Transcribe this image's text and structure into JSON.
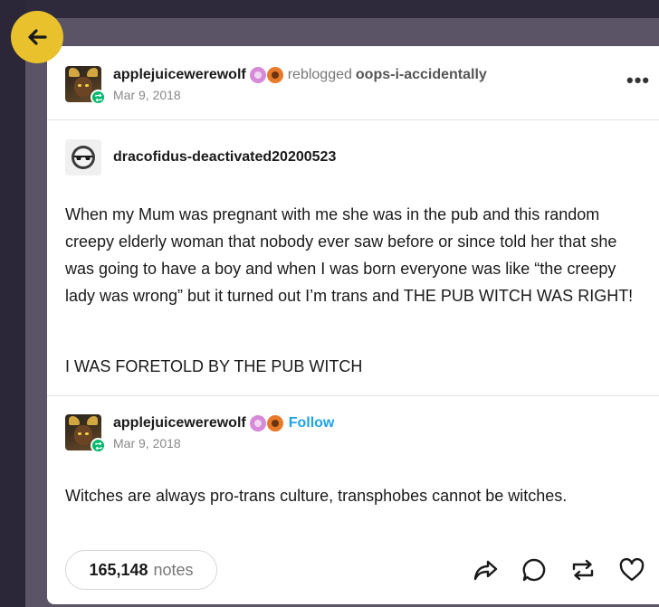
{
  "reblogger": {
    "username": "applejuicewerewolf",
    "action": "reblogged",
    "source": "oops-i-accidentally",
    "date": "Mar 9, 2018",
    "more_label": "•••"
  },
  "original_post": {
    "username": "dracofidus-deactivated20200523",
    "paragraphs": [
      "When my Mum was pregnant with me she was in the pub and this random creepy elderly woman that nobody ever saw before or since told her that she was going to have a boy and when I was born everyone was like “the creepy lady was wrong” but it turned out I’m trans and THE PUB WITCH WAS RIGHT!",
      "I WAS FORETOLD BY THE PUB WITCH"
    ]
  },
  "reply": {
    "username": "applejuicewerewolf",
    "follow_label": "Follow",
    "date": "Mar 9, 2018",
    "text": "Witches are always pro-trans culture, transphobes cannot be witches."
  },
  "footer": {
    "notes_count": "165,148",
    "notes_label": "notes"
  },
  "icons": {
    "back": "arrow-left-icon",
    "share": "share-icon",
    "reply": "comment-icon",
    "reblog": "reblog-icon",
    "like": "heart-icon"
  },
  "colors": {
    "accent_yellow": "#e8c12d",
    "follow_blue": "#1ea3e8",
    "reblog_green": "#00b86b"
  }
}
